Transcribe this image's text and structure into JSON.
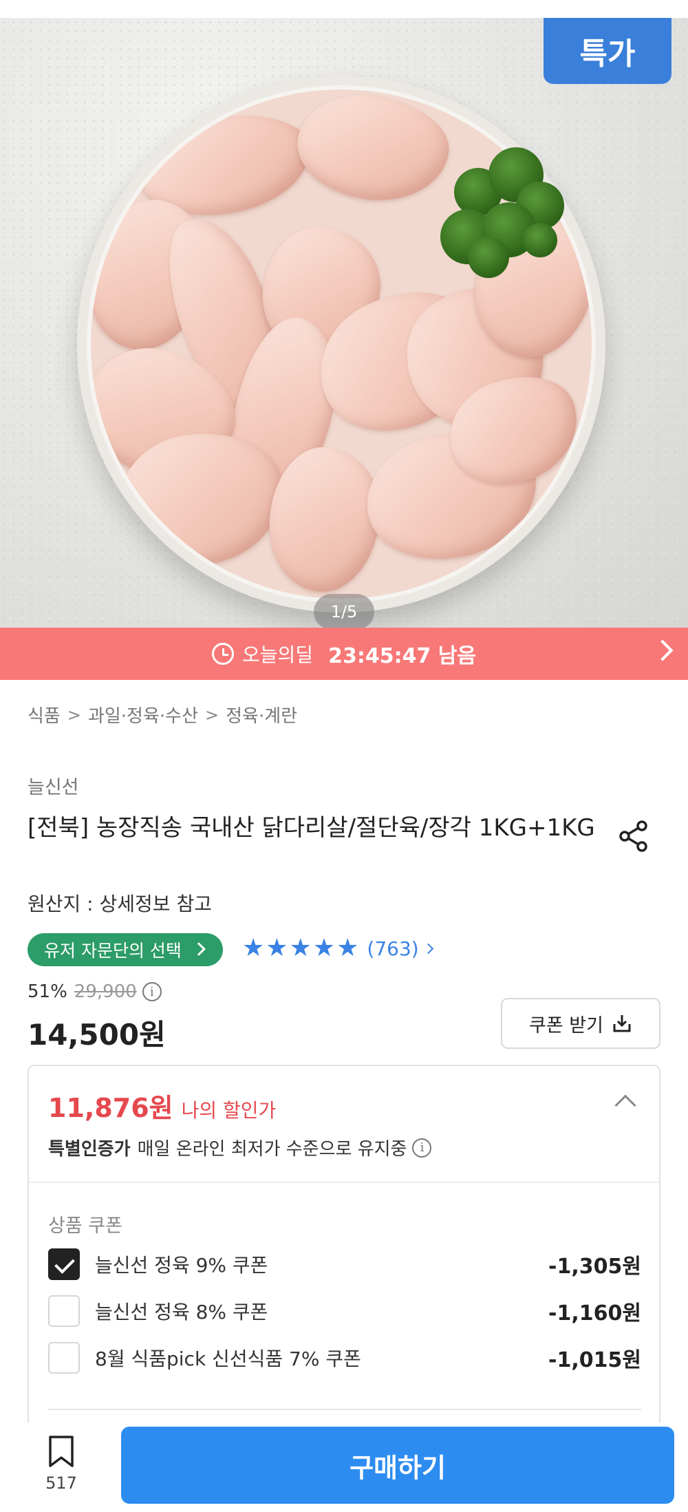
{
  "hero": {
    "badge_label": "특가",
    "pager": "1/5"
  },
  "deal": {
    "label": "오늘의딜",
    "time_left": "23:45:47 남음"
  },
  "breadcrumb": [
    "식품",
    "과일·정육·수산",
    "정육·계란"
  ],
  "product": {
    "seller": "늘신선",
    "title": "[전북] 농장직송 국내산 닭다리살/절단육/장각 1KG+1KG",
    "origin": "원산지 : 상세정보 참고",
    "advisor_badge": "유저 자문단의 선택",
    "rating": 5,
    "review_count": "(763)",
    "discount_rate": "51%",
    "original_price": "29,900",
    "price": "14,500원",
    "coupon_button": "쿠폰 받기"
  },
  "discount_box": {
    "my_price": "11,876원",
    "my_price_label": "나의 할인가",
    "certified_label": "특별인증가",
    "certified_text": "매일 온라인 최저가 수준으로 유지중",
    "coupon_section_title": "상품 쿠폰",
    "coupons": [
      {
        "name": "늘신선 정육 9% 쿠폰",
        "amount": "-1,305원",
        "checked": true
      },
      {
        "name": "늘신선 정육 8% 쿠폰",
        "amount": "-1,160원",
        "checked": false
      },
      {
        "name": "8월 식품pick 신선식품 7% 쿠폰",
        "amount": "-1,015원",
        "checked": false
      }
    ]
  },
  "bottom": {
    "bookmark_count": "517",
    "buy_label": "구매하기"
  },
  "colors": {
    "deal_bar": "#f87878",
    "accent_blue": "#2d8cf0",
    "advisor_green": "#2c9c68",
    "sale_red": "#e5484d"
  },
  "icons": [
    "clock-icon",
    "chevron-right-icon",
    "share-icon",
    "star-icon",
    "info-icon",
    "download-icon",
    "chevron-up-icon",
    "check-icon",
    "bookmark-icon"
  ]
}
